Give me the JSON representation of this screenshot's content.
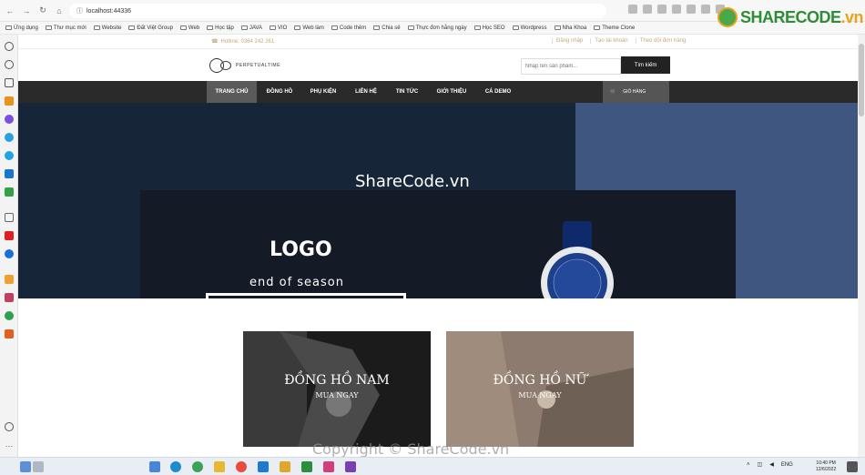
{
  "browser": {
    "url": "localhost:44336",
    "bookmarks": [
      "Ứng dụng",
      "Thư mục mới",
      "Website",
      "Đất Việt Group",
      "Web",
      "Học tập",
      "JAVA",
      "VIO",
      "Web làm",
      "Code thêm",
      "Chia sẻ",
      "Thực đơn hằng ngày",
      "Học SEO",
      "Wordpress",
      "Nha Khoa",
      "Theme Clone"
    ]
  },
  "watermark_logo": {
    "name": "SHARECODE",
    "suffix": ".vn"
  },
  "site": {
    "hotline": "Hotline: 0364 242 261",
    "top_links": [
      "Đăng nhập",
      "Tạo tài khoản",
      "Theo dõi đơn hàng"
    ],
    "brand": "PERPETUALTIME",
    "search": {
      "placeholder": "Nhập tên sản phẩm...",
      "button": "Tìm kiếm"
    },
    "nav": [
      "TRANG CHỦ",
      "ĐỒNG HỒ",
      "PHỤ KIỆN",
      "LIÊN HỆ",
      "TIN TỨC",
      "GIỚI THIỆU",
      "CÁ DEMO"
    ],
    "cart": "GIỎ HÀNG"
  },
  "hero": {
    "watermark": "ShareCode.vn",
    "logo": "LOGO",
    "subtitle": "end of season"
  },
  "categories": [
    {
      "title": "ĐỒNG HỒ NAM",
      "sub": "MUA NGAY"
    },
    {
      "title": "ĐỒNG HỒ NỮ",
      "sub": "MUA NGAY"
    }
  ],
  "copyright": "Copyright © ShareCode.vn",
  "taskbar": {
    "lang": "ENG",
    "time": "10:40 PM",
    "date": "12/6/2022"
  },
  "colors": {
    "nav": "#2a2a2a",
    "accent": "#c8a77a",
    "hero": "#172538"
  }
}
